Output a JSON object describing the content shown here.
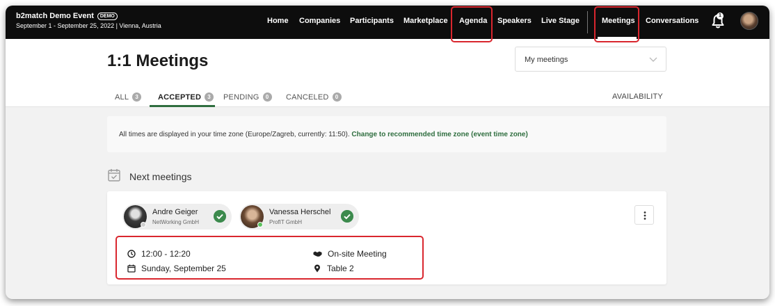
{
  "app": {
    "event_name": "b2match Demo Event",
    "demo_badge": "DEMO",
    "event_meta": "September 1 - September 25, 2022 | Vienna, Austria"
  },
  "nav": {
    "items": [
      "Home",
      "Companies",
      "Participants",
      "Marketplace",
      "Agenda",
      "Speakers",
      "Live Stage",
      "Meetings",
      "Conversations"
    ],
    "active": "Meetings",
    "notification_count": "1"
  },
  "page": {
    "title": "1:1 Meetings",
    "filter_select": {
      "value": "My meetings"
    },
    "tabs": [
      {
        "label": "ALL",
        "count": "3"
      },
      {
        "label": "ACCEPTED",
        "count": "3"
      },
      {
        "label": "PENDING",
        "count": "0"
      },
      {
        "label": "CANCELED",
        "count": "0"
      }
    ],
    "active_tab": "ACCEPTED",
    "availability_label": "AVAILABILITY"
  },
  "info_bar": {
    "text": "All times are displayed in your time zone (Europe/Zagreb, currently: 11:50).",
    "link": "Change to recommended time zone (event time zone)"
  },
  "next_meetings": {
    "title": "Next meetings",
    "meetings": [
      {
        "participants": [
          {
            "name": "Andre Geiger",
            "company": "NetWorking GmbH",
            "status": "offline"
          },
          {
            "name": "Vanessa Herschel",
            "company": "ProfIT GmbH",
            "status": "online"
          }
        ],
        "time": "12:00 - 12:20",
        "date": "Sunday, September 25",
        "type": "On-site Meeting",
        "location": "Table 2"
      }
    ]
  },
  "colors": {
    "accent": "#2f6e3f",
    "check": "#3c8a4d",
    "highlight": "#d9262e",
    "nav_bg": "#0d0d0d"
  },
  "icons": [
    "bell-icon",
    "chevron-down-icon",
    "calendar-check-icon",
    "check-circle-icon",
    "kebab-menu-icon",
    "clock-icon",
    "calendar-icon",
    "handshake-icon",
    "location-pin-icon"
  ]
}
